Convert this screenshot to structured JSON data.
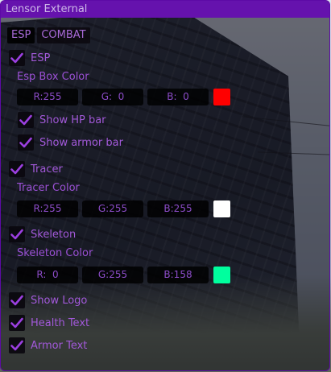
{
  "window": {
    "title": "Lensor External"
  },
  "tabs": [
    {
      "label": "ESP",
      "active": true
    },
    {
      "label": "COMBAT",
      "active": false
    }
  ],
  "esp": {
    "checkbox": {
      "label": "ESP",
      "checked": true
    },
    "box_color": {
      "label": "Esp Box Color",
      "r": "R:255",
      "g": "G:  0",
      "b": "B:  0",
      "swatch": "#ff0000"
    },
    "show_hp_bar": {
      "label": "Show HP bar",
      "checked": true
    },
    "show_armor_bar": {
      "label": "Show armor bar",
      "checked": true
    }
  },
  "tracer": {
    "checkbox": {
      "label": "Tracer",
      "checked": true
    },
    "color": {
      "label": "Tracer Color",
      "r": "R:255",
      "g": "G:255",
      "b": "B:255",
      "swatch": "#ffffff"
    }
  },
  "skeleton": {
    "checkbox": {
      "label": "Skeleton",
      "checked": true
    },
    "color": {
      "label": "Skeleton Color",
      "r": "R:  0",
      "g": "G:255",
      "b": "B:158",
      "swatch": "#00ff9e"
    }
  },
  "misc": {
    "show_logo": {
      "label": "Show Logo",
      "checked": true
    },
    "health_text": {
      "label": "Health Text",
      "checked": true
    },
    "armor_text": {
      "label": "Armor Text",
      "checked": true
    }
  },
  "colors": {
    "accent": "#a259d9",
    "titlebar": "#6512ad",
    "check": "#9b3fe0"
  }
}
